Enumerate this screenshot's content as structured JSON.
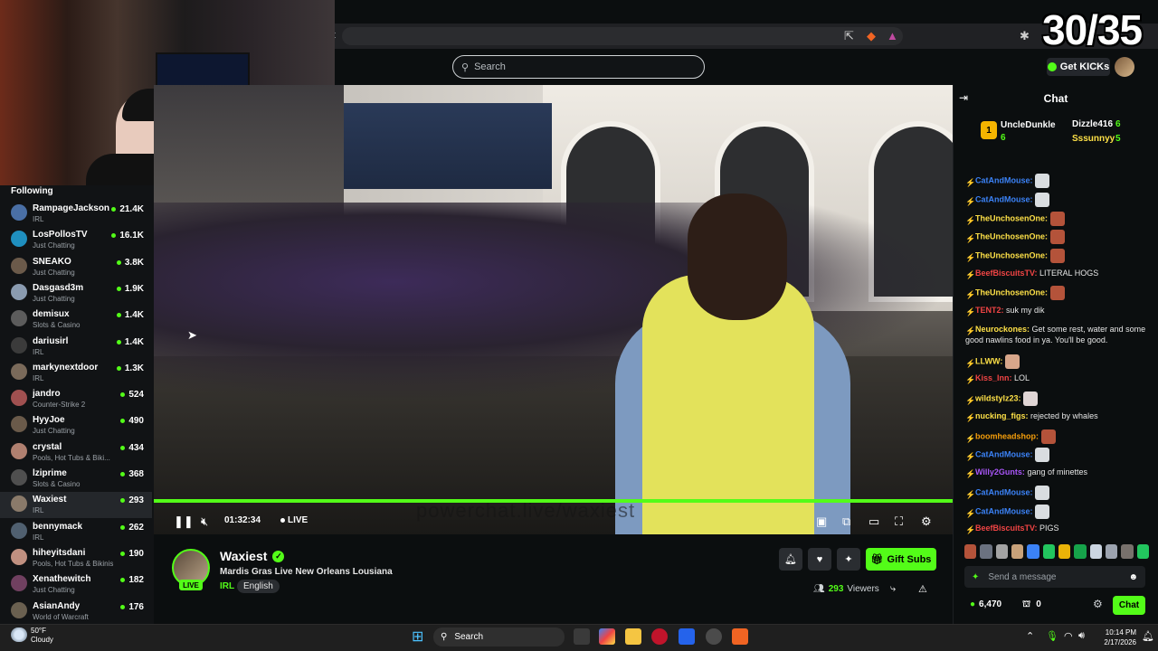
{
  "overlay": {
    "counter": "30/35"
  },
  "browser": {
    "url_fragment": "t"
  },
  "topbar": {
    "search_placeholder": "Search",
    "get_kicks": "Get KICKs"
  },
  "sidebar": {
    "title": "Following",
    "items": [
      {
        "name": "RampageJackson",
        "category": "IRL",
        "viewers": "21.4K",
        "avatar": "#4a6fa5"
      },
      {
        "name": "LosPollosTV",
        "category": "Just Chatting",
        "viewers": "16.1K",
        "avatar": "#1f8fbf"
      },
      {
        "name": "SNEAKO",
        "category": "Just Chatting",
        "viewers": "3.8K",
        "avatar": "#6b5a4a"
      },
      {
        "name": "Dasgasd3m",
        "category": "Just Chatting",
        "viewers": "1.9K",
        "avatar": "#8a9bb0"
      },
      {
        "name": "demisux",
        "category": "Slots & Casino",
        "viewers": "1.4K",
        "avatar": "#5c5c5c"
      },
      {
        "name": "dariusirl",
        "category": "IRL",
        "viewers": "1.4K",
        "avatar": "#3b3b3b"
      },
      {
        "name": "markynextdoor",
        "category": "IRL",
        "viewers": "1.3K",
        "avatar": "#7a6a5a"
      },
      {
        "name": "jandro",
        "category": "Counter-Strike 2",
        "viewers": "524",
        "avatar": "#a05050"
      },
      {
        "name": "HyyJoe",
        "category": "Just Chatting",
        "viewers": "490",
        "avatar": "#6a5a4a"
      },
      {
        "name": "crystal",
        "category": "Pools, Hot Tubs & Biki...",
        "viewers": "434",
        "avatar": "#b08070"
      },
      {
        "name": "lziprime",
        "category": "Slots & Casino",
        "viewers": "368",
        "avatar": "#4f4f4f"
      },
      {
        "name": "Waxiest",
        "category": "IRL",
        "viewers": "293",
        "avatar": "#8a7a6a"
      },
      {
        "name": "bennymack",
        "category": "IRL",
        "viewers": "262",
        "avatar": "#506070"
      },
      {
        "name": "hiheyitsdani",
        "category": "Pools, Hot Tubs & Bikinis",
        "viewers": "190",
        "avatar": "#c09080"
      },
      {
        "name": "Xenathewitch",
        "category": "Just Chatting",
        "viewers": "182",
        "avatar": "#704060"
      },
      {
        "name": "AsianAndy",
        "category": "World of Warcraft",
        "viewers": "176",
        "avatar": "#6a6050"
      }
    ]
  },
  "player": {
    "watermark": "powerchat.live/waxiest",
    "time": "01:32:34",
    "live": "LIVE",
    "progress": 1.0
  },
  "stream": {
    "name": "Waxiest",
    "live_badge": "LIVE",
    "title": "Mardis Gras Live New Orleans Lousiana",
    "category": "IRL",
    "language": "English",
    "gift_subs": "Gift Subs",
    "viewers_count": "293",
    "viewers_label": "Viewers"
  },
  "chat": {
    "title": "Chat",
    "top_gifters": [
      {
        "rank": "1",
        "name": "UncleDunkle",
        "count": "6"
      },
      {
        "name": "Dizzle416",
        "count": "6"
      },
      {
        "name": "Sssunnyy",
        "count": "5"
      }
    ],
    "messages": [
      {
        "user": "CatAndMouse:",
        "text": "",
        "color": "#3b82f6",
        "emote": "#d9dde0"
      },
      {
        "user": "CatAndMouse:",
        "text": "",
        "color": "#3b82f6",
        "emote": "#d9dde0"
      },
      {
        "user": "TheUnchosenOne:",
        "text": "",
        "color": "#fde047",
        "emote": "#b4533a"
      },
      {
        "user": "TheUnchosenOne:",
        "text": "",
        "color": "#fde047",
        "emote": "#b4533a"
      },
      {
        "user": "TheUnchosenOne:",
        "text": "",
        "color": "#fde047",
        "emote": "#b4533a"
      },
      {
        "user": "BeefBiscuitsTV:",
        "text": "LITERAL HOGS",
        "color": "#ef4444",
        "emote": ""
      },
      {
        "user": "TheUnchosenOne:",
        "text": "",
        "color": "#fde047",
        "emote": "#b4533a"
      },
      {
        "user": "TENT2:",
        "text": "suk my dik",
        "color": "#ef4444",
        "emote": ""
      },
      {
        "user": "Neurockones:",
        "text": "Get some rest, water and some good nawlins food in ya. You'll be good.",
        "color": "#fde047",
        "emote": ""
      },
      {
        "user": "LLWW:",
        "text": "",
        "color": "#fde047",
        "emote": "#d7a68a"
      },
      {
        "user": "Kiss_Inn:",
        "text": "LOL",
        "color": "#ef4444",
        "emote": ""
      },
      {
        "user": "wildstylz23:",
        "text": "",
        "color": "#fde047",
        "emote": "#e0d5d5"
      },
      {
        "user": "nucking_figs:",
        "text": "rejected by whales",
        "color": "#fde047",
        "emote": ""
      },
      {
        "user": "boomheadshop:",
        "text": "",
        "color": "#f59e0b",
        "emote": "#b4533a"
      },
      {
        "user": "CatAndMouse:",
        "text": "",
        "color": "#3b82f6",
        "emote": "#d9dde0"
      },
      {
        "user": "Willy2Gunts:",
        "text": "gang of minettes",
        "color": "#a855f7",
        "emote": ""
      },
      {
        "user": "CatAndMouse:",
        "text": "",
        "color": "#3b82f6",
        "emote": "#d9dde0"
      },
      {
        "user": "CatAndMouse:",
        "text": "",
        "color": "#3b82f6",
        "emote": "#d9dde0"
      },
      {
        "user": "BeefBiscuitsTV:",
        "text": "PIGS",
        "color": "#ef4444",
        "emote": ""
      }
    ],
    "input_placeholder": "Send a message",
    "kicks": "6,470",
    "zero": "0",
    "send_label": "Chat"
  },
  "taskbar": {
    "weather_temp": "50°F",
    "weather_desc": "Cloudy",
    "search": "Search",
    "time": "10:14 PM",
    "date": "2/17/2026"
  },
  "colors": {
    "accent": "#53fc18",
    "bg": "#0b0e0f"
  }
}
